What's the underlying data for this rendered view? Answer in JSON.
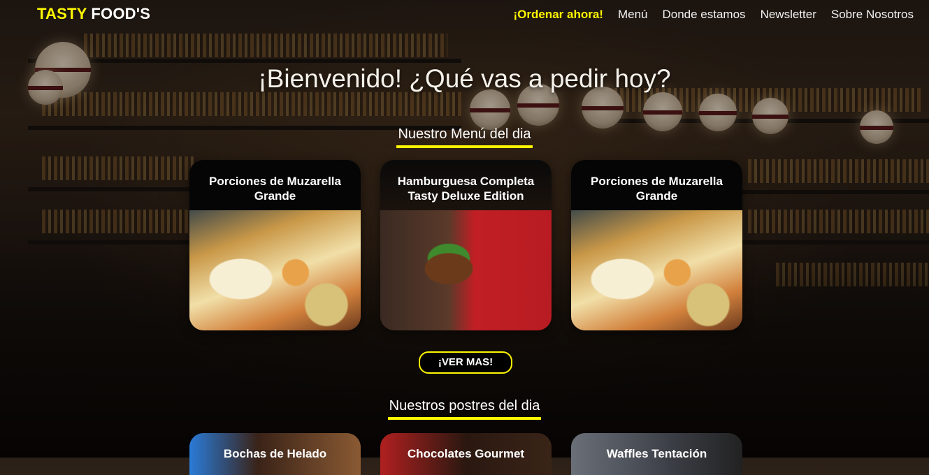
{
  "brand": {
    "part1": "TASTY",
    "part2": "FOOD'S"
  },
  "nav": {
    "items": [
      "¡Ordenar ahora!",
      "Menú",
      "Donde estamos",
      "Newsletter",
      "Sobre Nosotros"
    ]
  },
  "hero": {
    "title": "¡Bienvenido! ¿Qué vas a pedir hoy?"
  },
  "menu_section": {
    "title": "Nuestro Menú del dia",
    "cards": [
      {
        "title_line1": "Porciones de Muzarella",
        "title_line2": "Grande",
        "image": "pizza-image"
      },
      {
        "title_line1": "Hamburguesa Completa",
        "title_line2": "Tasty Deluxe Edition",
        "image": "burger-image"
      },
      {
        "title_line1": "Porciones de Muzarella",
        "title_line2": "Grande",
        "image": "pizza-image"
      }
    ],
    "more_button": "¡VER MAS!"
  },
  "desserts_section": {
    "title": "Nuestros postres del dia",
    "cards": [
      {
        "title": "Bochas de Helado"
      },
      {
        "title": "Chocolates Gourmet"
      },
      {
        "title": "Waffles Tentación"
      }
    ]
  },
  "colors": {
    "accent": "#fff700",
    "card_head": "#050505"
  }
}
